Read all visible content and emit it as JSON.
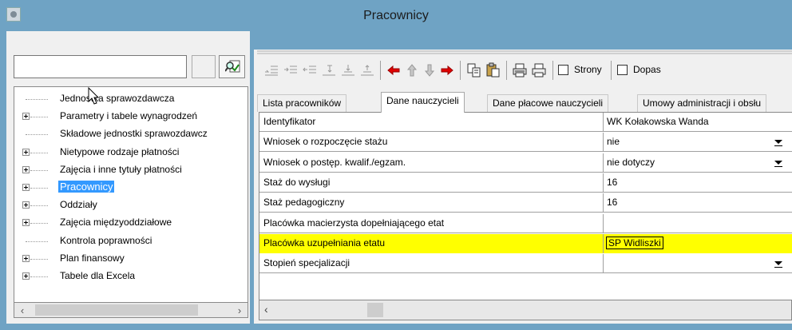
{
  "window": {
    "title": "Pracownicy"
  },
  "search": {
    "value": ""
  },
  "tree": {
    "items": [
      {
        "label": "Jednostka sprawozdawcza",
        "expandable": false
      },
      {
        "label": "Parametry i tabele wynagrodzeń",
        "expandable": true
      },
      {
        "label": "Składowe jednostki sprawozdawcz",
        "expandable": false
      },
      {
        "label": "Nietypowe rodzaje płatności",
        "expandable": true
      },
      {
        "label": "Zajęcia i inne tytuły płatności",
        "expandable": true
      },
      {
        "label": "Pracownicy",
        "expandable": true,
        "selected": true
      },
      {
        "label": "Oddziały",
        "expandable": true
      },
      {
        "label": "Zajęcia międzyoddziałowe",
        "expandable": true
      },
      {
        "label": "Kontrola poprawności",
        "expandable": false
      },
      {
        "label": "Plan finansowy",
        "expandable": true
      },
      {
        "label": "Tabele dla Excela",
        "expandable": true
      }
    ]
  },
  "toolbar": {
    "strony_label": "Strony",
    "dopasuj_label": "Dopas"
  },
  "tabs": [
    {
      "label": "Lista pracowników"
    },
    {
      "label": "Dane nauczycieli",
      "active": true
    },
    {
      "label": "Dane płacowe nauczycieli"
    },
    {
      "label": "Umowy administracji i obsłu"
    }
  ],
  "grid": {
    "rows": [
      {
        "key": "Identyfikator",
        "value": "WK Kołakowska Wanda",
        "dropdown": false
      },
      {
        "key": "Wniosek o rozpoczęcie stażu",
        "value": "nie",
        "dropdown": true
      },
      {
        "key": "Wniosek o postęp. kwalif./egzam.",
        "value": "nie dotyczy",
        "dropdown": true
      },
      {
        "key": "Staż do wysługi",
        "value": "16",
        "dropdown": false
      },
      {
        "key": "Staż pedagogiczny",
        "value": "16",
        "dropdown": false
      },
      {
        "key": "Placówka macierzysta dopełniającego etat",
        "value": "",
        "dropdown": false
      },
      {
        "key": "Placówka uzupełniania etatu",
        "value": "SP Widliszki",
        "dropdown": false,
        "highlighted": true
      },
      {
        "key": "Stopień specjalizacji",
        "value": "",
        "dropdown": true
      }
    ]
  },
  "colors": {
    "titlebar": "#6fa3c4",
    "selection": "#3399ff",
    "highlight": "#ffff00",
    "arrow_red": "#e00000"
  }
}
